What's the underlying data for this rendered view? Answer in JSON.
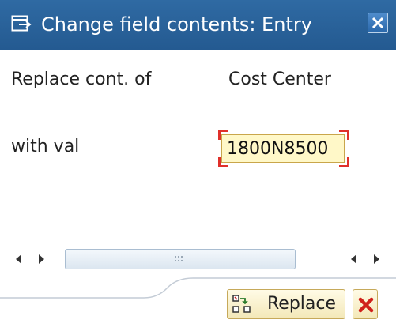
{
  "window": {
    "title": "Change field contents: Entry",
    "title_icon": "dialog-window-icon",
    "close_icon": "close-icon"
  },
  "form": {
    "replace_label": "Replace cont. of",
    "field_name": "Cost Center",
    "with_label": "with val",
    "value": "1800N8500"
  },
  "footer": {
    "replace_label": "Replace",
    "replace_icon": "replace-icon",
    "cancel_icon": "cancel-icon"
  },
  "colors": {
    "titlebar": "#2f6aa3",
    "field_background": "#fff8c8",
    "required_marker": "#e0302a",
    "button_background": "#f3e8b8",
    "cancel": "#d0201a"
  }
}
